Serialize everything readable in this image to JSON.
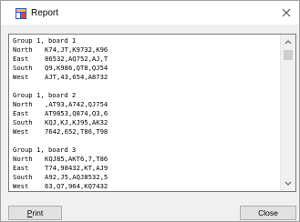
{
  "window": {
    "title": "Report"
  },
  "report": {
    "lines": [
      {
        "label": "Group 1, board 1",
        "value": ""
      },
      {
        "label": "North",
        "value": "K74,JT,K9732,K96"
      },
      {
        "label": "East",
        "value": "86532,AQ752,AJ,T"
      },
      {
        "label": "South",
        "value": "Q9,K986,QT8,QJ54"
      },
      {
        "label": "West",
        "value": "AJT,43,654,A8732"
      },
      {
        "label": "",
        "value": ""
      },
      {
        "label": "Group 1, board 2",
        "value": ""
      },
      {
        "label": "North",
        "value": ",AT93,A742,QJ754"
      },
      {
        "label": "East",
        "value": "AT9853,Q874,Q3,6"
      },
      {
        "label": "South",
        "value": "KQJ,KJ,KJ95,AK32"
      },
      {
        "label": "West",
        "value": "7642,652,T86,T98"
      },
      {
        "label": "",
        "value": ""
      },
      {
        "label": "Group 1, board 3",
        "value": ""
      },
      {
        "label": "North",
        "value": "KQJ85,AKT6,7,T86"
      },
      {
        "label": "East",
        "value": "T74,98432,KT,AJ9"
      },
      {
        "label": "South",
        "value": "A92,J5,AQJ8532,5"
      },
      {
        "label": "West",
        "value": "63,Q7,964,KQ7432"
      }
    ]
  },
  "buttons": {
    "print_label": "Print",
    "print_mnemonic": "P",
    "print_rest": "rint",
    "close_label": "Close"
  },
  "icons": {
    "app": "report-app-icon",
    "close": "close-icon",
    "scroll_up": "chevron-up-icon",
    "scroll_down": "chevron-down-icon"
  }
}
